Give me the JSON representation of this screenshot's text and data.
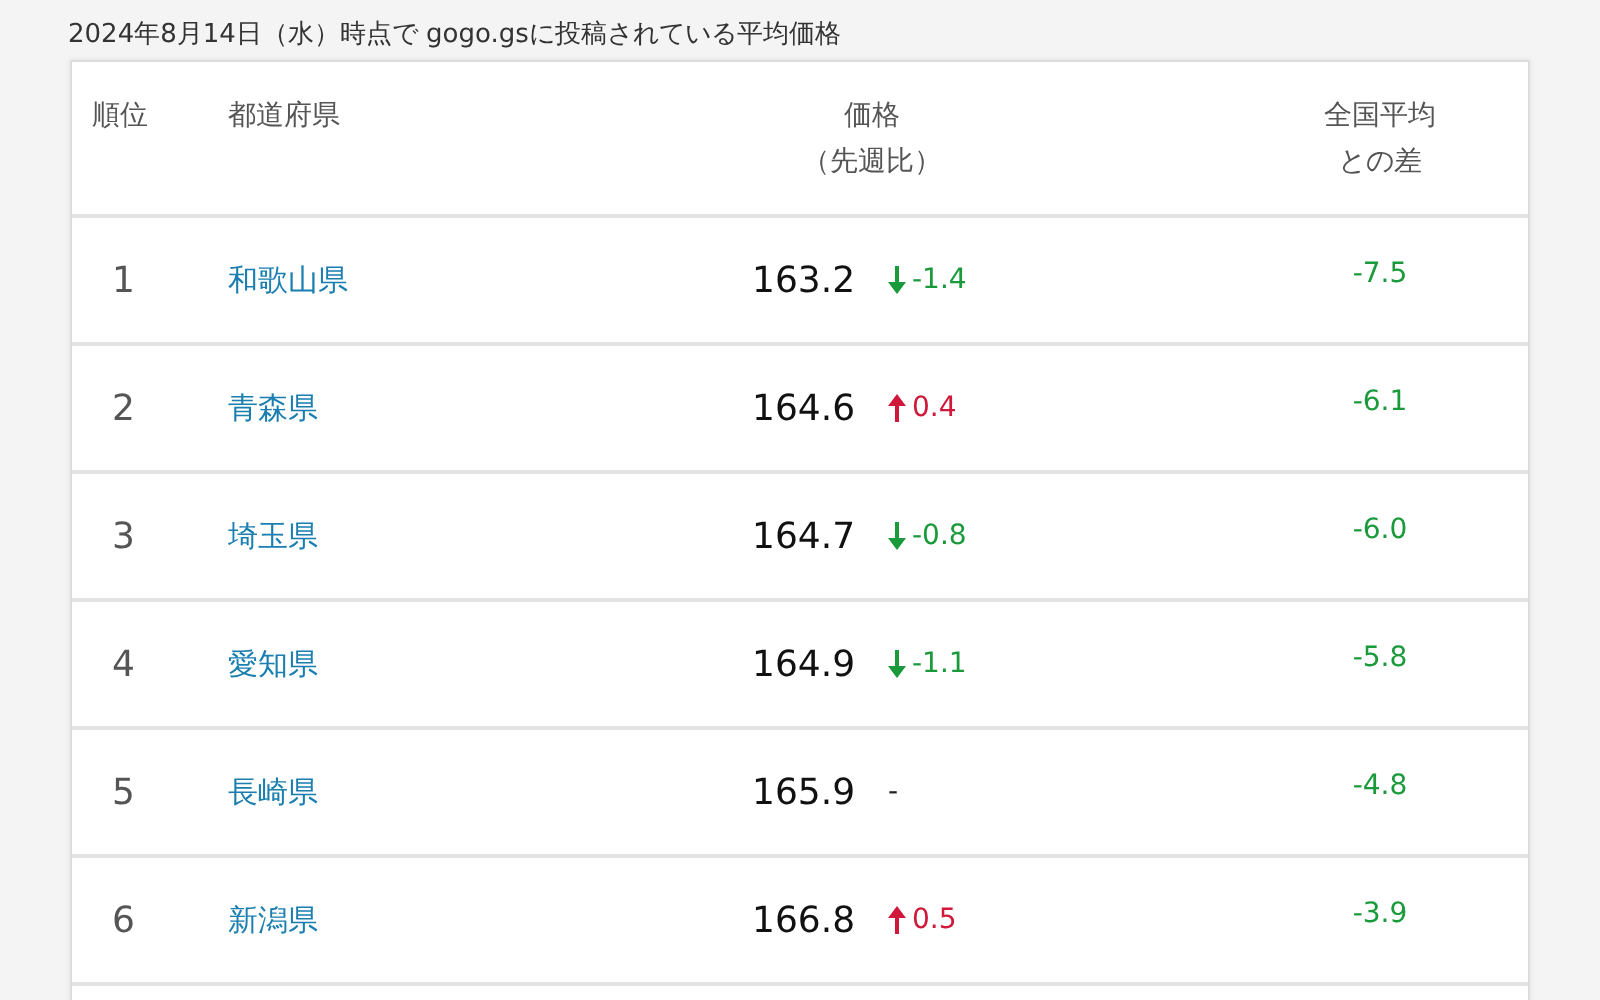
{
  "caption": "2024年8月14日（水）時点で gogo.gsに投稿されている平均価格",
  "table": {
    "columns": [
      {
        "lines": [
          "順位"
        ]
      },
      {
        "lines": [
          "都道府県"
        ]
      },
      {
        "lines": [
          "価格",
          "（先週比）"
        ]
      },
      {
        "lines": [
          "全国平均",
          "との差"
        ]
      }
    ],
    "rows": [
      {
        "rank": "1",
        "prefecture": "和歌山県",
        "price": "163.2",
        "change": {
          "kind": "down",
          "text": "-1.4"
        },
        "diff": "-7.5"
      },
      {
        "rank": "2",
        "prefecture": "青森県",
        "price": "164.6",
        "change": {
          "kind": "up",
          "text": "0.4"
        },
        "diff": "-6.1"
      },
      {
        "rank": "3",
        "prefecture": "埼玉県",
        "price": "164.7",
        "change": {
          "kind": "down",
          "text": "-0.8"
        },
        "diff": "-6.0"
      },
      {
        "rank": "4",
        "prefecture": "愛知県",
        "price": "164.9",
        "change": {
          "kind": "down",
          "text": "-1.1"
        },
        "diff": "-5.8"
      },
      {
        "rank": "5",
        "prefecture": "長崎県",
        "price": "165.9",
        "change": {
          "kind": "none",
          "text": "-"
        },
        "diff": "-4.8"
      },
      {
        "rank": "6",
        "prefecture": "新潟県",
        "price": "166.8",
        "change": {
          "kind": "up",
          "text": "0.5"
        },
        "diff": "-3.9"
      }
    ]
  }
}
